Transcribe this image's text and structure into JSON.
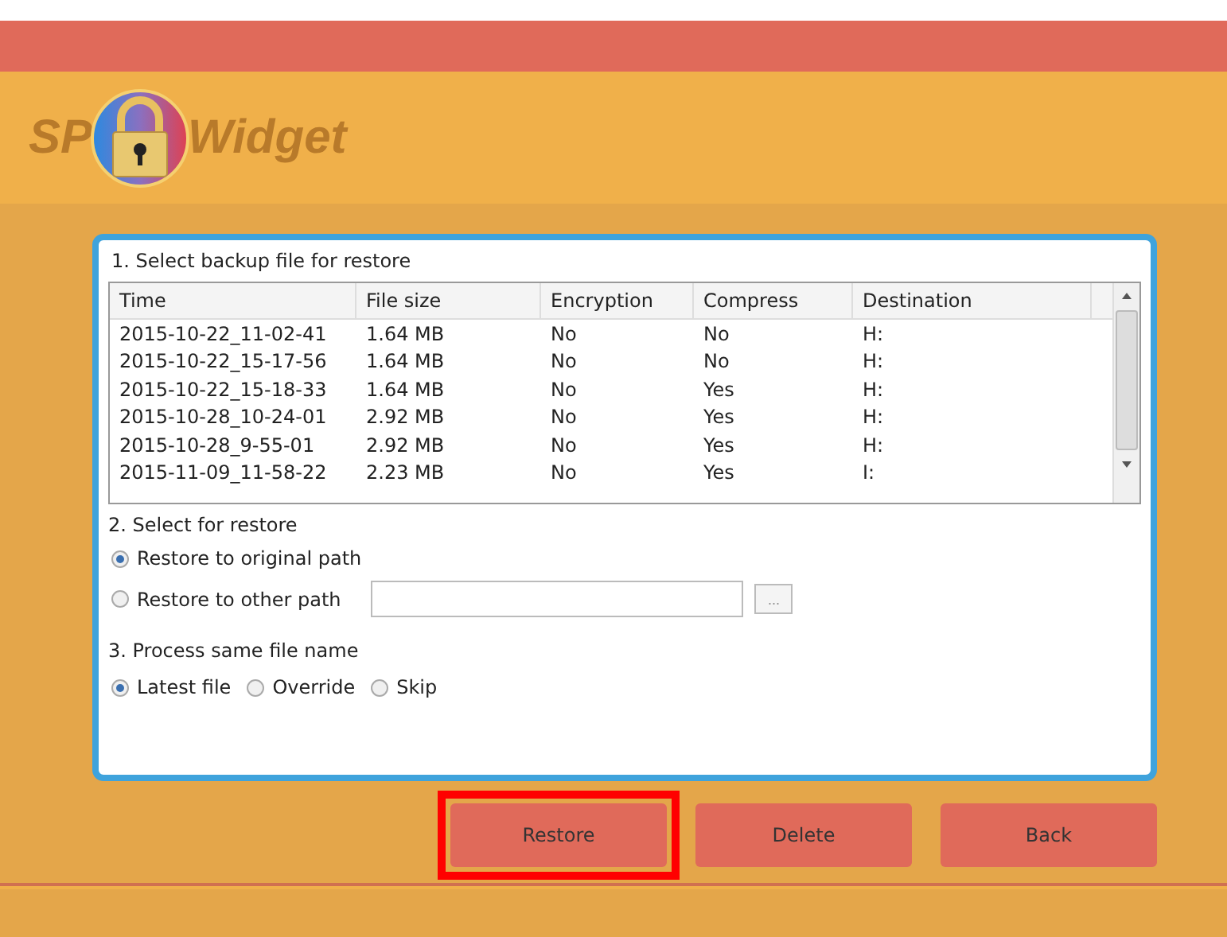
{
  "logo": {
    "prefix": "SP",
    "suffix": "Widget"
  },
  "section_1": {
    "title": "1. Select backup file for restore",
    "table": {
      "columns": [
        "Time",
        "File size",
        "Encryption",
        "Compress",
        "Destination"
      ],
      "rows": [
        [
          "2015-10-22_11-02-41",
          "1.64 MB",
          "No",
          "No",
          "H:"
        ],
        [
          "2015-10-22_15-17-56",
          "1.64 MB",
          "No",
          "No",
          "H:"
        ],
        [
          "2015-10-22_15-18-33",
          "1.64 MB",
          "No",
          "Yes",
          "H:"
        ],
        [
          "2015-10-28_10-24-01",
          "2.92 MB",
          "No",
          "Yes",
          "H:"
        ],
        [
          "2015-10-28_9-55-01",
          "2.92 MB",
          "No",
          "Yes",
          "H:"
        ],
        [
          "2015-11-09_11-58-22",
          "2.23 MB",
          "No",
          "Yes",
          "I:"
        ]
      ]
    }
  },
  "section_2": {
    "title": "2. Select for restore",
    "options": [
      {
        "label": "Restore to original path",
        "selected": true,
        "kind": "plain"
      },
      {
        "label": "Restore to other path",
        "selected": false,
        "kind": "path"
      }
    ],
    "browse_label": "..."
  },
  "section_3": {
    "title": "3. Process same file name",
    "options": [
      {
        "label": "Latest file",
        "selected": true
      },
      {
        "label": "Override",
        "selected": false
      },
      {
        "label": "Skip",
        "selected": false
      }
    ]
  },
  "buttons": [
    {
      "label": "Restore",
      "highlighted": true
    },
    {
      "label": "Delete",
      "highlighted": false
    },
    {
      "label": "Back",
      "highlighted": false
    }
  ]
}
